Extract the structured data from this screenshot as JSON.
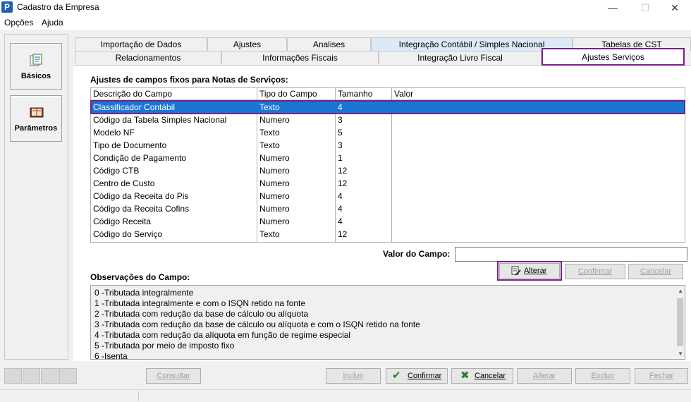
{
  "window": {
    "title": "Cadastro da Empresa",
    "app_icon": "P",
    "min_glyph": "—",
    "max_glyph": "☐",
    "close_glyph": "✕"
  },
  "menu": {
    "opcoes": "Opções",
    "ajuda": "Ajuda"
  },
  "sidebar": {
    "basicos": "Básicos",
    "parametros": "Parâmetros"
  },
  "tabs_row1": [
    "Importação de Dados",
    "Ajustes",
    "Analises",
    "Integração Contábil / Simples Nacional",
    "Tabelas de CST"
  ],
  "tabs_row2": [
    "Relacionamentos",
    "Informações Fiscais",
    "Integração Livro Fiscal",
    "Ajustes Serviços"
  ],
  "section_title": "Ajustes de campos fixos para Notas de Serviços:",
  "grid": {
    "headers": [
      "Descrição do Campo",
      "Tipo do Campo",
      "Tamanho",
      "Valor"
    ],
    "rows": [
      [
        "Classificador Contábil",
        "Texto",
        "4",
        ""
      ],
      [
        "Código da Tabela Simples Nacional",
        "Numero",
        "3",
        ""
      ],
      [
        "Modelo NF",
        "Texto",
        "5",
        ""
      ],
      [
        "Tipo de Documento",
        "Texto",
        "3",
        ""
      ],
      [
        "Condição de Pagamento",
        "Numero",
        "1",
        ""
      ],
      [
        "Código CTB",
        "Numero",
        "12",
        ""
      ],
      [
        "Centro de Custo",
        "Numero",
        "12",
        ""
      ],
      [
        "Código da Receita do Pis",
        "Numero",
        "4",
        ""
      ],
      [
        "Código da Receita Cofins",
        "Numero",
        "4",
        ""
      ],
      [
        "Código Receita",
        "Numero",
        "4",
        ""
      ],
      [
        "Código do Serviço",
        "Texto",
        "12",
        ""
      ]
    ]
  },
  "valor_campo": {
    "label": "Valor do Campo:",
    "value": ""
  },
  "field_buttons": {
    "alterar": "Alterar",
    "confirmar": "Confirmar",
    "cancelar": "Cancelar"
  },
  "obs": {
    "title": "Observações do Campo:",
    "lines": [
      "0 -Tributada integralmente",
      "1 -Tributada integralmente e com o ISQN retido na fonte",
      "2 -Tributada com redução da base de cálculo ou alíquota",
      "3 -Tributada com redução da base de cálculo ou alíquota e com o ISQN retido na fonte",
      "4 -Tributada com redução da alíquota em função de regime especial",
      "5 -Tributada por meio de imposto fixo",
      "6 -Isenta"
    ]
  },
  "bottom": {
    "consultar": "Consultar",
    "incluir": "Incluir",
    "confirmar": "Confirmar",
    "cancelar": "Cancelar",
    "alterar": "Alterar",
    "excluir": "Excluir",
    "fechar": "Fechar"
  },
  "colors": {
    "selection": "#1977d3",
    "highlight_frame": "#7b1e8c",
    "tab_light": "#dde9f6"
  }
}
